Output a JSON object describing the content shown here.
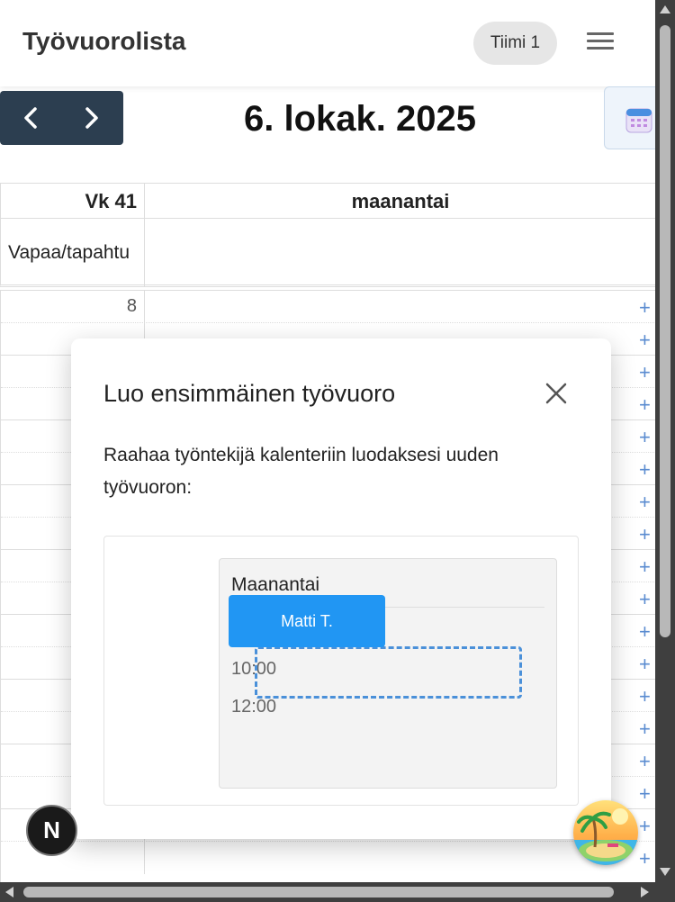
{
  "header": {
    "title": "Työvuorolista",
    "team": "Tiimi 1",
    "menu_icon": "hamburger-menu-icon"
  },
  "toolbar": {
    "prev_icon": "chevron-left-icon",
    "next_icon": "chevron-right-icon",
    "date_title": "6. lokak. 2025",
    "calendar_icon": "calendar-icon"
  },
  "calendar": {
    "week_label": "Vk 41",
    "day_label": "maanantai",
    "allday_label": "Vapaa/tapahtu",
    "first_hour": "8",
    "add_slot_icon": "plus-icon",
    "add_slot_symbol": "+"
  },
  "modal": {
    "title": "Luo ensimmäinen työvuoro",
    "close_icon": "close-icon",
    "description": "Raahaa työntekijä kalenteriin luodaksesi uuden työvuoron:",
    "demo": {
      "day_name": "Maanantai",
      "employee": "Matti T.",
      "time_1": "10:00",
      "time_2": "12:00"
    }
  },
  "floating": {
    "framework_badge": "N",
    "vacation_icon": "palm-beach-icon"
  },
  "colors": {
    "nav_bg": "#2c3e50",
    "employee_chip": "#2196f3",
    "drop_outline": "#4a90d9",
    "plus": "#5a8bd0"
  }
}
